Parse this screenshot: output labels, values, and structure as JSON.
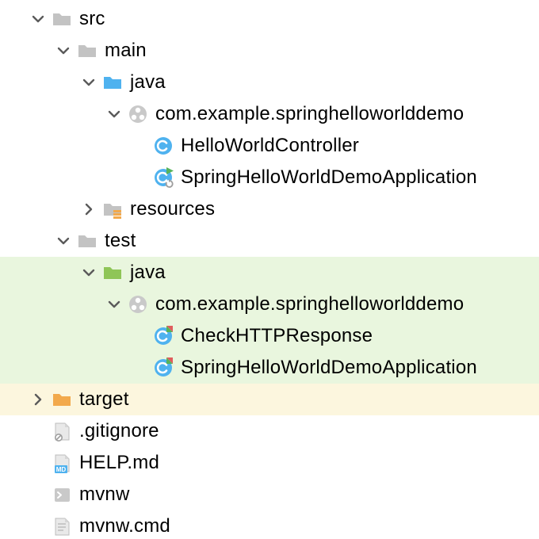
{
  "tree": {
    "src": {
      "label": "src",
      "main": {
        "label": "main",
        "java": {
          "label": "java",
          "pkg": {
            "label": "com.example.springhelloworlddemo",
            "controller": {
              "label": "HelloWorldController"
            },
            "app": {
              "label": "SpringHelloWorldDemoApplication"
            }
          }
        },
        "resources": {
          "label": "resources"
        }
      },
      "test": {
        "label": "test",
        "java": {
          "label": "java",
          "pkg": {
            "label": "com.example.springhelloworlddemo",
            "check": {
              "label": "CheckHTTPResponse"
            },
            "app": {
              "label": "SpringHelloWorldDemoApplication"
            }
          }
        }
      }
    },
    "target": {
      "label": "target"
    },
    "gitignore": {
      "label": ".gitignore"
    },
    "help": {
      "label": "HELP.md"
    },
    "mvnw": {
      "label": "mvnw"
    },
    "mvnwcmd": {
      "label": "mvnw.cmd"
    }
  },
  "icons": {
    "folder_gray": "folder-icon",
    "folder_blue": "folder-blue-icon",
    "folder_green": "folder-green-icon",
    "folder_orange": "folder-orange-icon",
    "package": "package-icon",
    "class": "class-icon",
    "class_run": "class-run-icon",
    "class_test": "class-test-icon",
    "resources": "resources-folder-icon",
    "file_ignore": "gitignore-file-icon",
    "file_md": "md-file-icon",
    "file_sh": "shell-file-icon",
    "file_txt": "text-file-icon"
  }
}
